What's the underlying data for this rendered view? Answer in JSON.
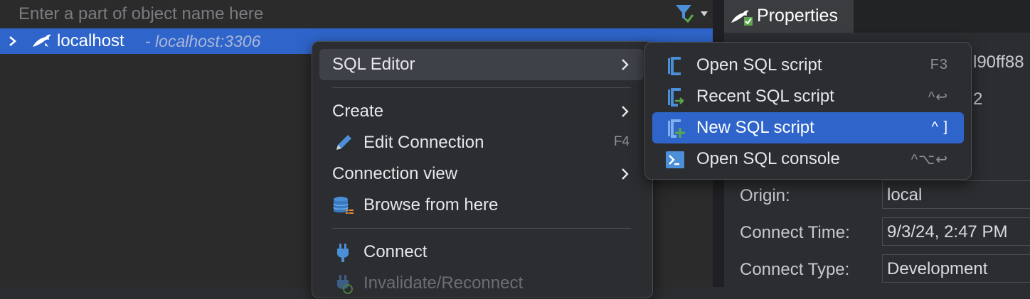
{
  "navigator": {
    "filter_placeholder": "Enter a part of object name here",
    "tree": {
      "label": "localhost",
      "host": "- localhost:3306",
      "icon": "dolphin-icon"
    }
  },
  "properties": {
    "tab_label": "Properties",
    "partial_values": [
      "l90ff88",
      "2"
    ],
    "rows": [
      {
        "label": "Origin:",
        "value": "local"
      },
      {
        "label": "Connect Time:",
        "value": "9/3/24, 2:47 PM"
      },
      {
        "label": "Connect Type:",
        "value": "Development"
      }
    ]
  },
  "context_menu": {
    "items": [
      {
        "label": "SQL Editor",
        "has_submenu": true
      },
      {
        "label": "Create",
        "has_submenu": true
      },
      {
        "label": "Edit Connection",
        "shortcut": "F4",
        "icon": "pencil-icon"
      },
      {
        "label": "Connection view",
        "has_submenu": true
      },
      {
        "label": "Browse from here",
        "icon": "database-icon"
      },
      {
        "label": "Connect",
        "icon": "plug-icon"
      },
      {
        "label": "Invalidate/Reconnect",
        "icon": "plug-refresh-icon",
        "disabled": true
      }
    ]
  },
  "submenu": {
    "items": [
      {
        "label": "Open SQL script",
        "shortcut": "F3",
        "icon": "sql-script-icon"
      },
      {
        "label": "Recent SQL script",
        "shortcut": "^↩",
        "icon": "recent-sql-script-icon"
      },
      {
        "label": "New SQL script",
        "shortcut": "^ ]",
        "icon": "new-sql-script-icon",
        "selected": true
      },
      {
        "label": "Open SQL console",
        "shortcut": "^⌥↩",
        "icon": "console-icon"
      }
    ]
  },
  "colors": {
    "selection": "#2f65ca",
    "menu_bg": "#2b2d30",
    "accent_green": "#5aa84b",
    "icon_blue": "#4a8fd8"
  }
}
